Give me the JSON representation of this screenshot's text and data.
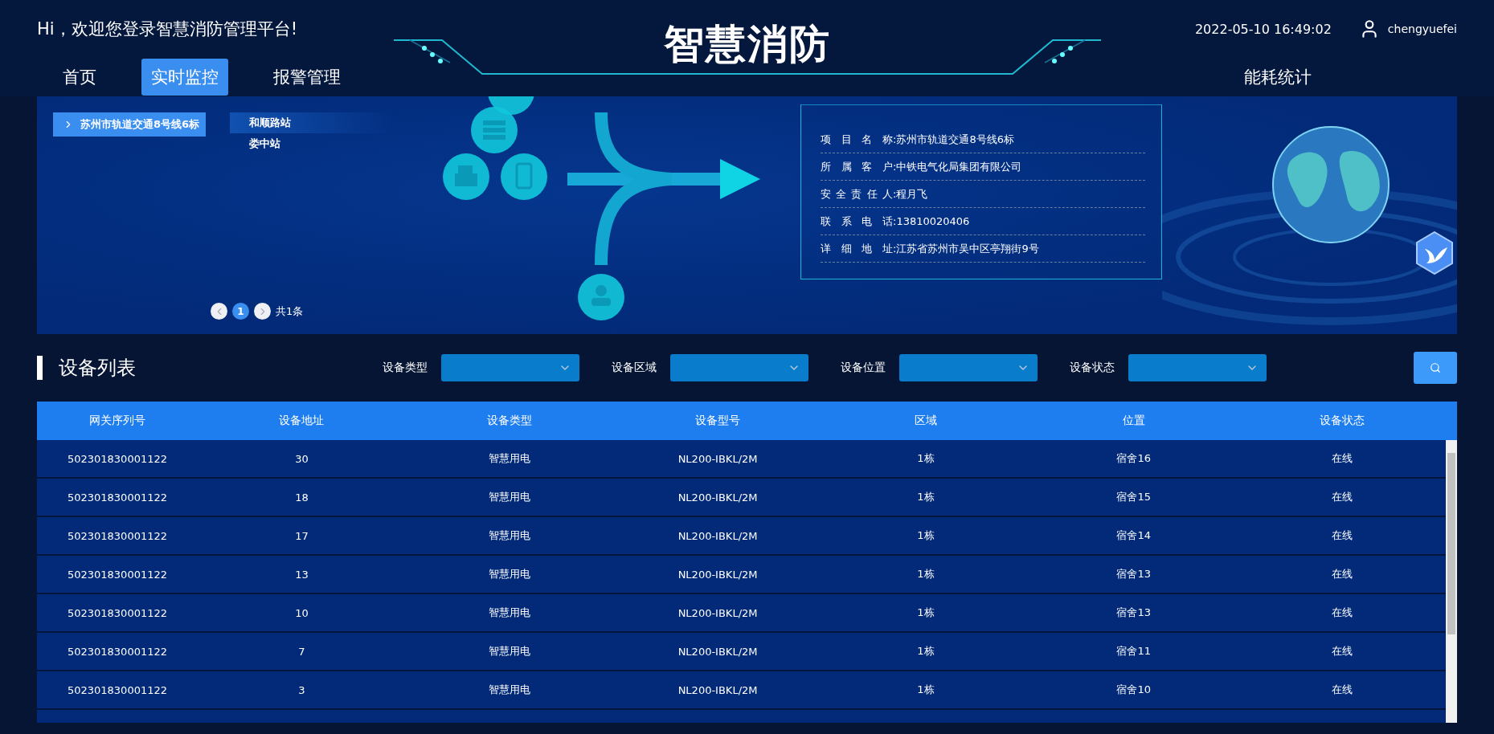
{
  "header": {
    "greeting": "Hi，欢迎您登录智慧消防管理平台!",
    "title": "智慧消防",
    "datetime": "2022-05-10 16:49:02",
    "username": "chengyuefei"
  },
  "nav": [
    {
      "label": "首页",
      "selected": false
    },
    {
      "label": "实时监控",
      "selected": true
    },
    {
      "label": "报警管理",
      "selected": false
    },
    {
      "label": "能耗统计",
      "selected": false
    }
  ],
  "projects": [
    {
      "label": "苏州市轨道交通8号线6标",
      "selected": true
    }
  ],
  "stations": [
    {
      "label": "和顺路站",
      "selected": true
    },
    {
      "label": "娄中站",
      "selected": false
    }
  ],
  "pagination": {
    "pages": [
      {
        "label": "1",
        "selected": true
      }
    ],
    "total": "共1条"
  },
  "project_info": [
    {
      "label": "项 目 名 称",
      "value": ":苏州市轨道交通8号线6标"
    },
    {
      "label": "所 属 客 户",
      "value": ":中铁电气化局集团有限公司"
    },
    {
      "label": "安 全 责 任 人",
      "value": ":程月飞"
    },
    {
      "label": "联 系 电 话",
      "value": ":13810020406"
    },
    {
      "label": "详 细 地 址",
      "value": ":江苏省苏州市吴中区亭翔街9号"
    }
  ],
  "section": {
    "title": "设备列表"
  },
  "filters": [
    {
      "label": "设备类型"
    },
    {
      "label": "设备区域"
    },
    {
      "label": "设备位置"
    },
    {
      "label": "设备状态"
    }
  ],
  "table": {
    "columns": [
      "网关序列号",
      "设备地址",
      "设备类型",
      "设备型号",
      "区域",
      "位置",
      "设备状态"
    ],
    "rows": [
      [
        "502301830001122",
        "30",
        "智慧用电",
        "NL200-IBKL/2M",
        "1栋",
        "宿舍16",
        "在线"
      ],
      [
        "502301830001122",
        "18",
        "智慧用电",
        "NL200-IBKL/2M",
        "1栋",
        "宿舍15",
        "在线"
      ],
      [
        "502301830001122",
        "17",
        "智慧用电",
        "NL200-IBKL/2M",
        "1栋",
        "宿舍14",
        "在线"
      ],
      [
        "502301830001122",
        "13",
        "智慧用电",
        "NL200-IBKL/2M",
        "1栋",
        "宿舍13",
        "在线"
      ],
      [
        "502301830001122",
        "10",
        "智慧用电",
        "NL200-IBKL/2M",
        "1栋",
        "宿舍13",
        "在线"
      ],
      [
        "502301830001122",
        "7",
        "智慧用电",
        "NL200-IBKL/2M",
        "1栋",
        "宿舍11",
        "在线"
      ],
      [
        "502301830001122",
        "3",
        "智慧用电",
        "NL200-IBKL/2M",
        "1栋",
        "宿舍10",
        "在线"
      ]
    ]
  }
}
